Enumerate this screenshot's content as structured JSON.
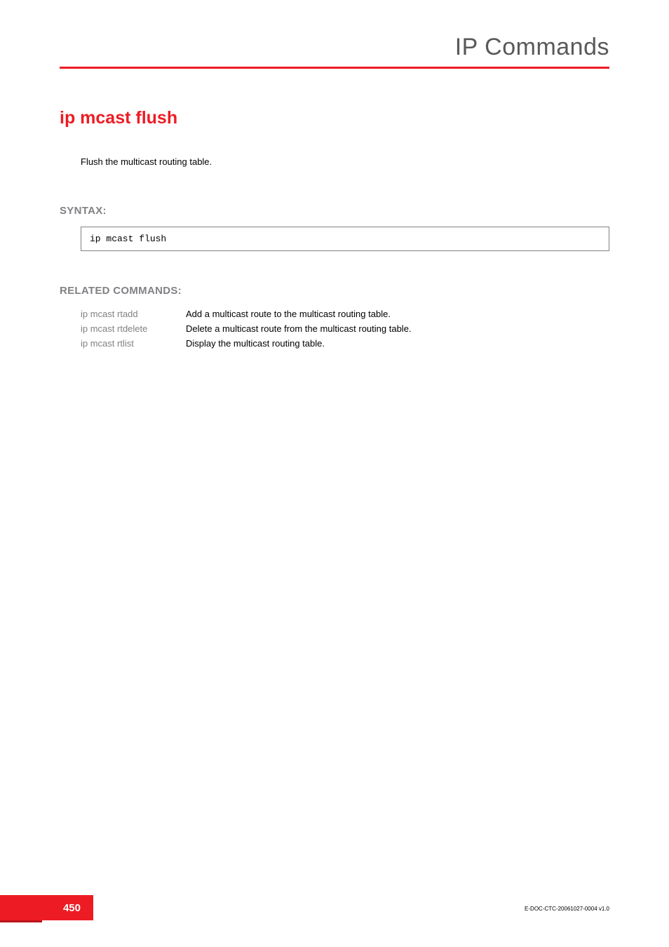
{
  "chapter_title": "IP Commands",
  "command_title": "ip mcast flush",
  "description": "Flush the multicast routing table.",
  "syntax_heading": "SYNTAX:",
  "syntax_code": "ip mcast flush",
  "related_heading": "RELATED COMMANDS:",
  "related": [
    {
      "cmd": "ip mcast rtadd",
      "desc": "Add a multicast route to the multicast routing table."
    },
    {
      "cmd": "ip mcast rtdelete",
      "desc": "Delete a multicast route from the multicast routing table."
    },
    {
      "cmd": "ip mcast rtlist",
      "desc": "Display the multicast routing table."
    }
  ],
  "page_number": "450",
  "doc_ref": "E-DOC-CTC-20061027-0004 v1.0"
}
